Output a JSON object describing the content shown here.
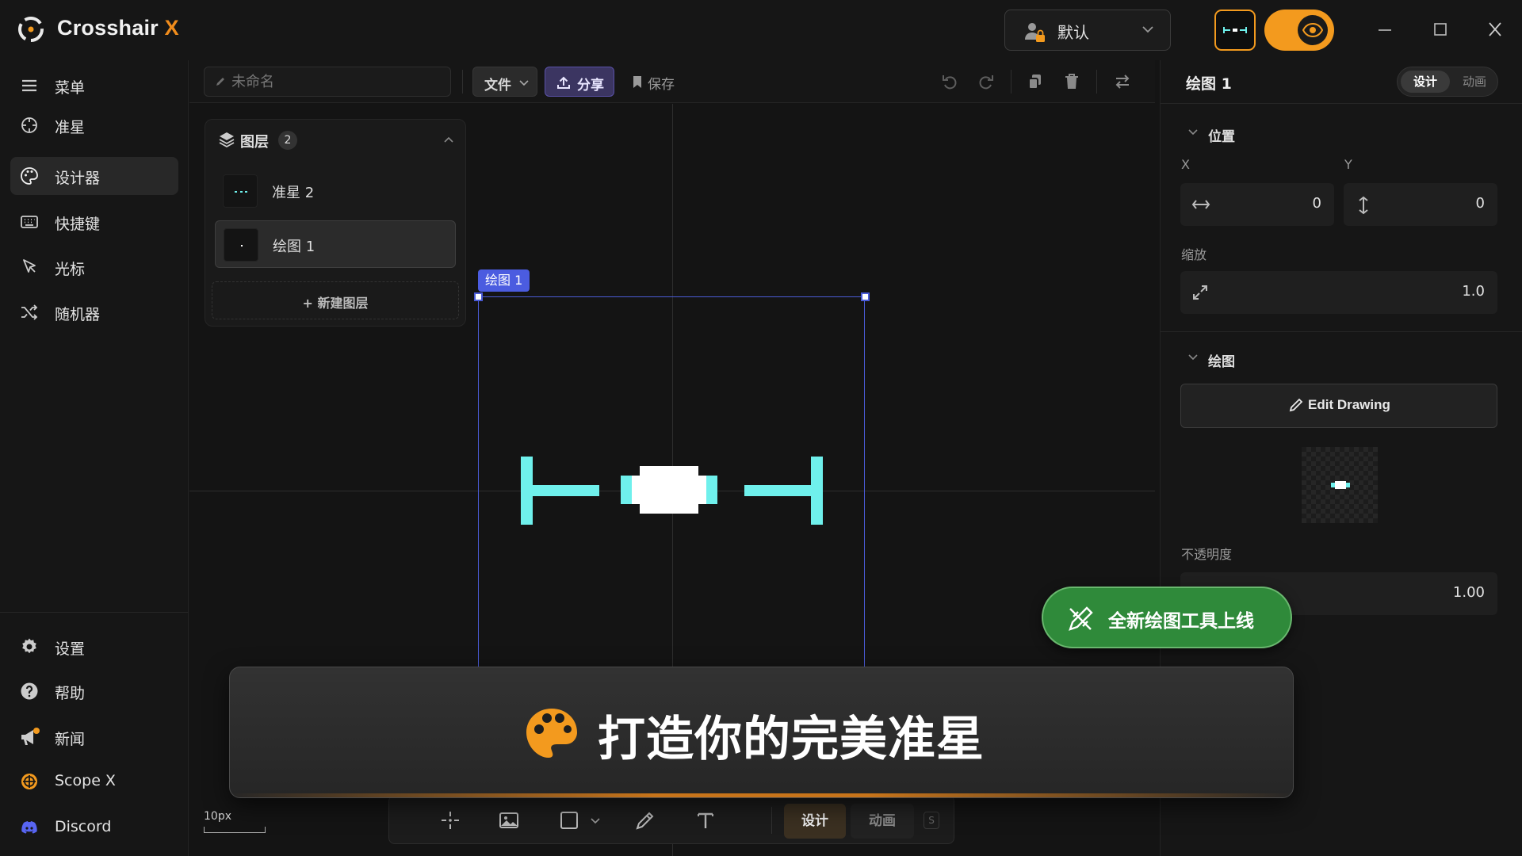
{
  "app": {
    "brand_main": "Crosshair ",
    "brand_accent": "X",
    "accent_color": "#f39a1e"
  },
  "profile": {
    "label": "默认"
  },
  "sidebar": {
    "items": [
      {
        "label": "菜单",
        "icon": "menu-icon"
      },
      {
        "label": "准星",
        "icon": "crosshair-icon"
      },
      {
        "label": "设计器",
        "icon": "palette-icon",
        "active": true
      },
      {
        "label": "快捷键",
        "icon": "keyboard-icon"
      },
      {
        "label": "光标",
        "icon": "cursor-icon"
      },
      {
        "label": "随机器",
        "icon": "shuffle-icon"
      }
    ],
    "bottom_items": [
      {
        "label": "设置",
        "icon": "gear-icon"
      },
      {
        "label": "帮助",
        "icon": "help-icon"
      },
      {
        "label": "新闻",
        "icon": "megaphone-icon"
      },
      {
        "label": "Scope X",
        "icon": "scope-icon"
      },
      {
        "label": "Discord",
        "icon": "discord-icon"
      }
    ]
  },
  "toolbar": {
    "name_placeholder": "未命名",
    "file_label": "文件",
    "share_label": "分享",
    "save_label": "保存"
  },
  "layers": {
    "title": "图层",
    "count": "2",
    "items": [
      {
        "name": "准星 2",
        "active": false
      },
      {
        "name": "绘图 1",
        "active": true
      }
    ],
    "add_label": "+ 新建图层"
  },
  "canvas": {
    "selection_label": "绘图 1",
    "scale_label": "10px",
    "crosshair_color": "#6ff0ec"
  },
  "bottom_tools": {
    "design_tab": "设计",
    "animate_tab": "动画",
    "shortcut": "S"
  },
  "right_panel": {
    "title": "绘图 1",
    "tab_design": "设计",
    "tab_animate": "动画",
    "position": {
      "title": "位置",
      "x_label": "X",
      "y_label": "Y",
      "x": "0",
      "y": "0"
    },
    "scale": {
      "label": "缩放",
      "value": "1.0"
    },
    "drawing": {
      "title": "绘图",
      "edit_label": "Edit Drawing"
    },
    "opacity": {
      "label": "不透明度",
      "value": "1.00"
    }
  },
  "promo": {
    "badge": "全新绘图工具上线",
    "banner": "打造你的完美准星"
  }
}
